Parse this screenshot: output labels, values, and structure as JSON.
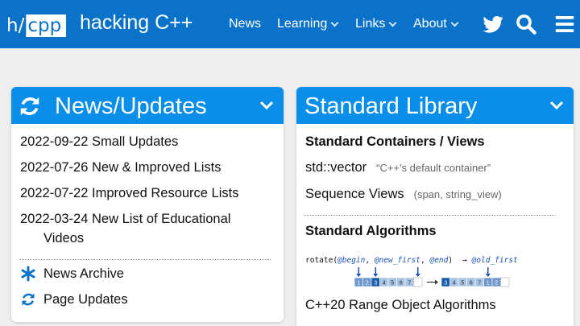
{
  "header": {
    "logo_h": "h/",
    "logo_cpp": "cpp",
    "site_title": "hacking C++",
    "nav": [
      {
        "label": "News"
      },
      {
        "label": "Learning"
      },
      {
        "label": "Links"
      },
      {
        "label": "About"
      }
    ]
  },
  "news_panel": {
    "title": "News/Updates",
    "items": [
      "2022-09-22 Small Updates",
      "2022-07-26 New & Improved Lists",
      "2022-07-22 Improved Resource Lists"
    ],
    "multiline_item": {
      "line1": "2022-03-24 New List of Educational",
      "line2": "Videos"
    },
    "links": [
      "News Archive",
      "Page Updates"
    ]
  },
  "library_panel": {
    "title": "Standard Library",
    "section1": "Standard Containers / Views",
    "item1": {
      "name": "std::vector",
      "note": "“C++'s default container”"
    },
    "item2": {
      "name": "Sequence Views",
      "note": "(span, string_view)"
    },
    "section2": "Standard Algorithms",
    "code": {
      "fn": "rotate(",
      "a1": "@begin",
      "sep1": ", ",
      "a2": "@new_first",
      "sep2": ", ",
      "a3": "@end",
      "close": ")",
      "arrow": "→",
      "ret": "@old_first"
    },
    "before_cells": [
      "1",
      "2",
      "3",
      "4",
      "5",
      "6",
      "7"
    ],
    "after_cells": [
      "3",
      "4",
      "5",
      "6",
      "7",
      "1",
      "2"
    ],
    "item3": "C++20 Range Object Algorithms"
  },
  "colors": {
    "topbar": "#0b72c9",
    "panel_header": "#0b8ee8",
    "background": "#eeeeee"
  }
}
